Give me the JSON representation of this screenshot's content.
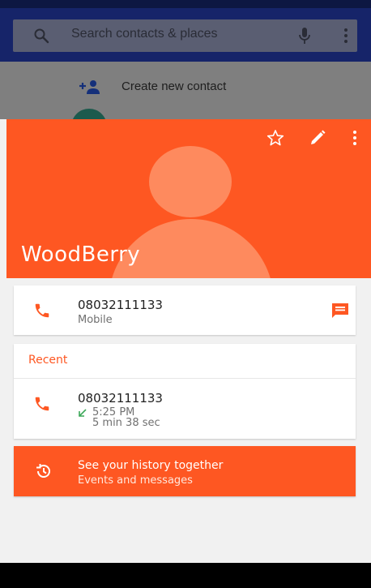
{
  "search": {
    "placeholder": "Search contacts & places"
  },
  "behind": {
    "create_label": "Create new contact"
  },
  "contact": {
    "name": "WoodBerry"
  },
  "phone": {
    "number": "08032111133",
    "type": "Mobile"
  },
  "recent": {
    "header": "Recent",
    "number": "08032111133",
    "time": "5:25 PM",
    "duration": "5 min 38 sec"
  },
  "history": {
    "title": "See your history together",
    "subtitle": "Events and messages"
  },
  "colors": {
    "accent": "#fe5722",
    "accent_light": "#fe8a5e",
    "dialer_header": "#162469",
    "call_incoming": "#3aa757"
  },
  "icons": {
    "search": "search-icon",
    "mic": "mic-icon",
    "more": "more-vert-icon",
    "add_contact": "person-add-icon",
    "star": "star-outline-icon",
    "edit": "edit-icon",
    "phone": "phone-icon",
    "message": "message-icon",
    "incoming": "incoming-call-arrow-icon",
    "history": "history-icon"
  }
}
